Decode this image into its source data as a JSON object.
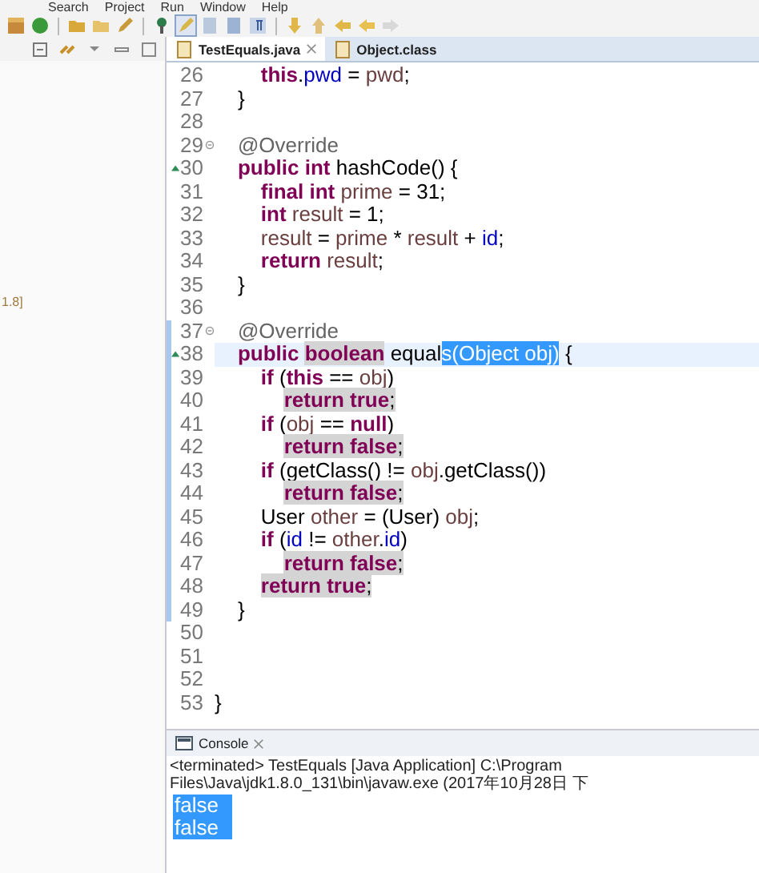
{
  "menu": [
    "Search",
    "Project",
    "Run",
    "Window",
    "Help"
  ],
  "tabs": [
    {
      "label": "TestEquals.java",
      "selected": true
    },
    {
      "label": "Object.class",
      "selected": false
    }
  ],
  "left_panel": {
    "text": "1.8]"
  },
  "editor": {
    "lines": [
      {
        "num": "26",
        "foldable": false,
        "overrides": false,
        "changed": false,
        "current": false,
        "tokens": [
          {
            "text": "        this",
            "kind": "keyword"
          },
          {
            "text": ".",
            "kind": "plain"
          },
          {
            "text": "pwd",
            "kind": "field"
          },
          {
            "text": " = ",
            "kind": "plain"
          },
          {
            "text": "pwd",
            "kind": "local"
          },
          {
            "text": ";",
            "kind": "plain"
          }
        ]
      },
      {
        "num": "27",
        "foldable": false,
        "overrides": false,
        "changed": false,
        "current": false,
        "tokens": [
          {
            "text": "    }",
            "kind": "plain"
          }
        ]
      },
      {
        "num": "28",
        "foldable": false,
        "overrides": false,
        "changed": false,
        "current": false
      },
      {
        "num": "29",
        "foldable": true,
        "overrides": false,
        "changed": false,
        "current": false,
        "tokens": [
          {
            "text": "    @Override",
            "kind": "annotation"
          }
        ]
      },
      {
        "num": "30",
        "foldable": false,
        "overrides": true,
        "changed": false,
        "current": false,
        "tokens": [
          {
            "text": "    public int",
            "kind": "keyword"
          },
          {
            "text": " hashCode() {",
            "kind": "plain"
          }
        ]
      },
      {
        "num": "31",
        "foldable": false,
        "overrides": false,
        "changed": false,
        "current": false,
        "tokens": [
          {
            "text": "        final int ",
            "kind": "keyword"
          },
          {
            "text": "prime",
            "kind": "local"
          },
          {
            "text": " = 31;",
            "kind": "plain"
          }
        ]
      },
      {
        "num": "32",
        "foldable": false,
        "overrides": false,
        "changed": false,
        "current": false,
        "tokens": [
          {
            "text": "        int ",
            "kind": "keyword"
          },
          {
            "text": "result",
            "kind": "local"
          },
          {
            "text": " = 1;",
            "kind": "plain"
          }
        ]
      },
      {
        "num": "33",
        "foldable": false,
        "overrides": false,
        "changed": false,
        "current": false,
        "tokens": [
          {
            "text": "        result",
            "kind": "local"
          },
          {
            "text": " = ",
            "kind": "plain"
          },
          {
            "text": "prime",
            "kind": "local"
          },
          {
            "text": " * ",
            "kind": "plain"
          },
          {
            "text": "result",
            "kind": "local"
          },
          {
            "text": " + ",
            "kind": "plain"
          },
          {
            "text": "id",
            "kind": "field"
          },
          {
            "text": ";",
            "kind": "plain"
          }
        ]
      },
      {
        "num": "34",
        "foldable": false,
        "overrides": false,
        "changed": false,
        "current": false,
        "tokens": [
          {
            "text": "        return ",
            "kind": "keyword"
          },
          {
            "text": "result",
            "kind": "local"
          },
          {
            "text": ";",
            "kind": "plain"
          }
        ]
      },
      {
        "num": "35",
        "foldable": false,
        "overrides": false,
        "changed": false,
        "current": false,
        "tokens": [
          {
            "text": "    }",
            "kind": "plain"
          }
        ]
      },
      {
        "num": "36",
        "foldable": false,
        "overrides": false,
        "changed": false,
        "current": false
      },
      {
        "num": "37",
        "foldable": true,
        "overrides": false,
        "changed": true,
        "current": false,
        "tokens": [
          {
            "text": "    @Override",
            "kind": "annotation"
          }
        ]
      },
      {
        "num": "38",
        "foldable": false,
        "overrides": true,
        "changed": true,
        "current": true,
        "tokens": [
          {
            "text": "    public ",
            "kind": "keyword"
          },
          {
            "text": "boolean",
            "kind": "keyword",
            "occurrence": true
          },
          {
            "text": " equal",
            "kind": "plain"
          },
          {
            "text": "s(Object obj)",
            "kind": "plain",
            "selected": true
          },
          {
            "text": " {",
            "kind": "plain"
          }
        ]
      },
      {
        "num": "39",
        "foldable": false,
        "overrides": false,
        "changed": true,
        "current": false,
        "tokens": [
          {
            "text": "        if",
            "kind": "keyword"
          },
          {
            "text": " (",
            "kind": "plain"
          },
          {
            "text": "this",
            "kind": "keyword"
          },
          {
            "text": " == ",
            "kind": "plain"
          },
          {
            "text": "obj",
            "kind": "local"
          },
          {
            "text": ")",
            "kind": "plain"
          }
        ]
      },
      {
        "num": "40",
        "foldable": false,
        "overrides": false,
        "changed": true,
        "current": false,
        "tokens": [
          {
            "text": "            return true",
            "kind": "keyword",
            "occurrence": true
          },
          {
            "text": ";",
            "kind": "plain",
            "occurrence": true
          }
        ]
      },
      {
        "num": "41",
        "foldable": false,
        "overrides": false,
        "changed": true,
        "current": false,
        "tokens": [
          {
            "text": "        if",
            "kind": "keyword"
          },
          {
            "text": " (",
            "kind": "plain"
          },
          {
            "text": "obj",
            "kind": "local"
          },
          {
            "text": " == ",
            "kind": "plain"
          },
          {
            "text": "null",
            "kind": "keyword"
          },
          {
            "text": ")",
            "kind": "plain"
          }
        ]
      },
      {
        "num": "42",
        "foldable": false,
        "overrides": false,
        "changed": true,
        "current": false,
        "tokens": [
          {
            "text": "            return false",
            "kind": "keyword",
            "occurrence": true
          },
          {
            "text": ";",
            "kind": "plain",
            "occurrence": true
          }
        ]
      },
      {
        "num": "43",
        "foldable": false,
        "overrides": false,
        "changed": true,
        "current": false,
        "tokens": [
          {
            "text": "        if",
            "kind": "keyword"
          },
          {
            "text": " (getClass() != ",
            "kind": "plain"
          },
          {
            "text": "obj",
            "kind": "local"
          },
          {
            "text": ".getClass())",
            "kind": "plain"
          }
        ]
      },
      {
        "num": "44",
        "foldable": false,
        "overrides": false,
        "changed": true,
        "current": false,
        "tokens": [
          {
            "text": "            return false",
            "kind": "keyword",
            "occurrence": true
          },
          {
            "text": ";",
            "kind": "plain",
            "occurrence": true
          }
        ]
      },
      {
        "num": "45",
        "foldable": false,
        "overrides": false,
        "changed": true,
        "current": false,
        "tokens": [
          {
            "text": "        User ",
            "kind": "plain"
          },
          {
            "text": "other",
            "kind": "local"
          },
          {
            "text": " = (User) ",
            "kind": "plain"
          },
          {
            "text": "obj",
            "kind": "local"
          },
          {
            "text": ";",
            "kind": "plain"
          }
        ]
      },
      {
        "num": "46",
        "foldable": false,
        "overrides": false,
        "changed": true,
        "current": false,
        "tokens": [
          {
            "text": "        if",
            "kind": "keyword"
          },
          {
            "text": " (",
            "kind": "plain"
          },
          {
            "text": "id",
            "kind": "field"
          },
          {
            "text": " != ",
            "kind": "plain"
          },
          {
            "text": "other",
            "kind": "local"
          },
          {
            "text": ".",
            "kind": "plain"
          },
          {
            "text": "id",
            "kind": "field"
          },
          {
            "text": ")",
            "kind": "plain"
          }
        ]
      },
      {
        "num": "47",
        "foldable": false,
        "overrides": false,
        "changed": true,
        "current": false,
        "tokens": [
          {
            "text": "            return false",
            "kind": "keyword",
            "occurrence": true
          },
          {
            "text": ";",
            "kind": "plain",
            "occurrence": true
          }
        ]
      },
      {
        "num": "48",
        "foldable": false,
        "overrides": false,
        "changed": true,
        "current": false,
        "tokens": [
          {
            "text": "        return true",
            "kind": "keyword",
            "occurrence": true
          },
          {
            "text": ";",
            "kind": "plain",
            "occurrence": true
          }
        ]
      },
      {
        "num": "49",
        "foldable": false,
        "overrides": false,
        "changed": true,
        "current": false,
        "tokens": [
          {
            "text": "    }",
            "kind": "plain"
          }
        ]
      },
      {
        "num": "50",
        "foldable": false,
        "overrides": false,
        "changed": false,
        "current": false
      },
      {
        "num": "51",
        "foldable": false,
        "overrides": false,
        "changed": false,
        "current": false
      },
      {
        "num": "52",
        "foldable": false,
        "overrides": false,
        "changed": false,
        "current": false
      },
      {
        "num": "53",
        "foldable": false,
        "overrides": false,
        "changed": false,
        "current": false,
        "tokens": [
          {
            "text": "}",
            "kind": "plain"
          }
        ]
      }
    ]
  },
  "console": {
    "title": "Console",
    "header": "<terminated> TestEquals [Java Application] C:\\Program Files\\Java\\jdk1.8.0_131\\bin\\javaw.exe (2017年10月28日 下",
    "lines": [
      {
        "text": "false",
        "selected": true
      },
      {
        "text": "false",
        "selected": true
      }
    ]
  }
}
